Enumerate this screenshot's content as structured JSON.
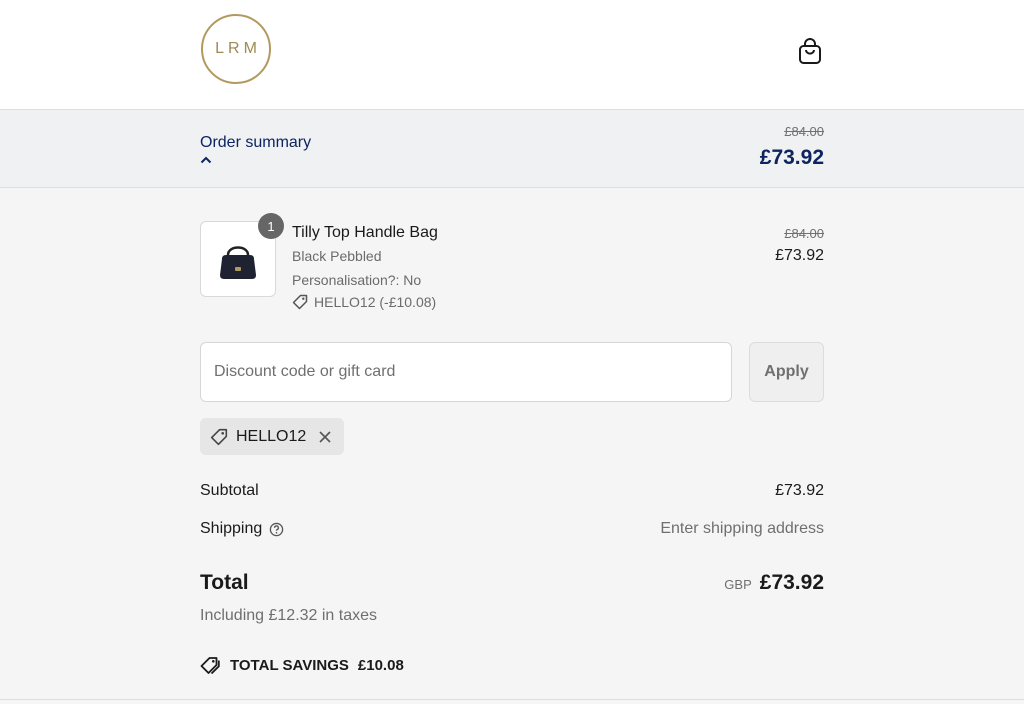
{
  "header": {
    "logo_text": "LRM",
    "cart_icon": "shopping-bag-icon"
  },
  "summary": {
    "label": "Order summary",
    "toggle_icon": "chevron-up-icon",
    "original_price": "£84.00",
    "price": "£73.92"
  },
  "line_item": {
    "quantity": "1",
    "title": "Tilly Top Handle Bag",
    "variant": "Black Pebbled",
    "personalisation": "Personalisation?: No",
    "discount_icon": "tag-icon",
    "discount": "HELLO12 (-£10.08)",
    "original_price": "£84.00",
    "price": "£73.92",
    "image_icon": "handbag-image"
  },
  "discount_form": {
    "placeholder": "Discount code or gift card",
    "value": "",
    "apply_label": "Apply"
  },
  "applied_code": {
    "icon": "tag-icon",
    "code": "HELLO12",
    "remove_icon": "close-icon"
  },
  "totals": {
    "subtotal_label": "Subtotal",
    "subtotal_value": "£73.92",
    "shipping_label": "Shipping",
    "shipping_help_icon": "question-circle-icon",
    "shipping_value": "Enter shipping address",
    "total_label": "Total",
    "currency": "GBP",
    "total_value": "£73.92",
    "taxes_note": "Including £12.32 in taxes",
    "savings_icon": "tags-icon",
    "savings_label": "TOTAL SAVINGS",
    "savings_value": "£10.08"
  },
  "colors": {
    "brand_gold": "#b29a5e",
    "navy": "#0d2461",
    "background": "#f5f5f5"
  }
}
